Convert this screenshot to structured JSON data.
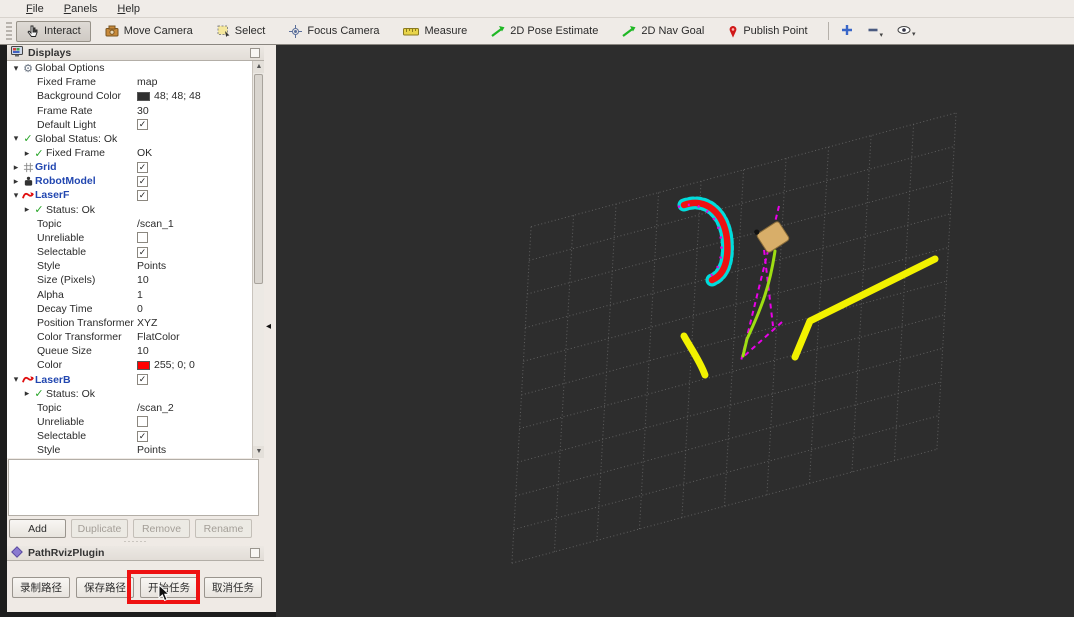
{
  "menu_bar": {
    "items": [
      {
        "label": "File"
      },
      {
        "label": "Panels"
      },
      {
        "label": "Help"
      }
    ]
  },
  "toolbar": {
    "tools": [
      {
        "label": "Interact",
        "icon": "interact-hand-icon",
        "active": true
      },
      {
        "label": "Move Camera",
        "icon": "move-camera-icon",
        "active": false
      },
      {
        "label": "Select",
        "icon": "select-box-icon",
        "active": false
      },
      {
        "label": "Focus Camera",
        "icon": "focus-camera-icon",
        "active": false
      },
      {
        "label": "Measure",
        "icon": "measure-ruler-icon",
        "active": false
      },
      {
        "label": "2D Pose Estimate",
        "icon": "pose-estimate-arrow-icon",
        "active": false
      },
      {
        "label": "2D Nav Goal",
        "icon": "nav-goal-arrow-icon",
        "active": false
      },
      {
        "label": "Publish Point",
        "icon": "publish-point-pin-icon",
        "active": false
      }
    ],
    "icon_tools": [
      {
        "name": "add-tool-plus-icon",
        "has_dropdown": false
      },
      {
        "name": "remove-tool-minus-icon",
        "has_dropdown": true
      },
      {
        "name": "tool-properties-eye-icon",
        "has_dropdown": true
      }
    ]
  },
  "displays_panel": {
    "title": "Displays",
    "tree": [
      {
        "indent": 0,
        "expander": "open",
        "icon": "gear-icon",
        "label": "Global Options",
        "style": "plain",
        "value": null
      },
      {
        "indent": 1,
        "expander": null,
        "icon": null,
        "label": "Fixed Frame",
        "style": "plain",
        "value": {
          "type": "text",
          "text": "map"
        }
      },
      {
        "indent": 1,
        "expander": null,
        "icon": null,
        "label": "Background Color",
        "style": "plain",
        "value": {
          "type": "color",
          "hex": "#303030",
          "text": "48; 48; 48"
        }
      },
      {
        "indent": 1,
        "expander": null,
        "icon": null,
        "label": "Frame Rate",
        "style": "plain",
        "value": {
          "type": "text",
          "text": "30"
        }
      },
      {
        "indent": 1,
        "expander": null,
        "icon": null,
        "label": "Default Light",
        "style": "plain",
        "value": {
          "type": "checkbox",
          "checked": true
        }
      },
      {
        "indent": 0,
        "expander": "open",
        "icon": "status-ok-icon",
        "label": "Global Status: Ok",
        "style": "plain",
        "value": null
      },
      {
        "indent": 1,
        "expander": "closed",
        "icon": "status-ok-icon",
        "label": "Fixed Frame",
        "style": "plain",
        "value": {
          "type": "text",
          "text": "OK"
        }
      },
      {
        "indent": 0,
        "expander": "closed",
        "icon": "grid-icon",
        "label": "Grid",
        "style": "blue",
        "value": {
          "type": "checkbox",
          "checked": true
        }
      },
      {
        "indent": 0,
        "expander": "closed",
        "icon": "robot-icon",
        "label": "RobotModel",
        "style": "blue",
        "value": {
          "type": "checkbox",
          "checked": true
        }
      },
      {
        "indent": 0,
        "expander": "open",
        "icon": "laser-icon",
        "label": "LaserF",
        "style": "blue",
        "value": {
          "type": "checkbox",
          "checked": true
        }
      },
      {
        "indent": 1,
        "expander": "closed",
        "icon": "status-ok-icon",
        "label": "Status: Ok",
        "style": "plain",
        "value": null
      },
      {
        "indent": 1,
        "expander": null,
        "icon": null,
        "label": "Topic",
        "style": "plain",
        "value": {
          "type": "text",
          "text": "/scan_1"
        }
      },
      {
        "indent": 1,
        "expander": null,
        "icon": null,
        "label": "Unreliable",
        "style": "plain",
        "value": {
          "type": "checkbox",
          "checked": false
        }
      },
      {
        "indent": 1,
        "expander": null,
        "icon": null,
        "label": "Selectable",
        "style": "plain",
        "value": {
          "type": "checkbox",
          "checked": true
        }
      },
      {
        "indent": 1,
        "expander": null,
        "icon": null,
        "label": "Style",
        "style": "plain",
        "value": {
          "type": "text",
          "text": "Points"
        }
      },
      {
        "indent": 1,
        "expander": null,
        "icon": null,
        "label": "Size (Pixels)",
        "style": "plain",
        "value": {
          "type": "text",
          "text": "10"
        }
      },
      {
        "indent": 1,
        "expander": null,
        "icon": null,
        "label": "Alpha",
        "style": "plain",
        "value": {
          "type": "text",
          "text": "1"
        }
      },
      {
        "indent": 1,
        "expander": null,
        "icon": null,
        "label": "Decay Time",
        "style": "plain",
        "value": {
          "type": "text",
          "text": "0"
        }
      },
      {
        "indent": 1,
        "expander": null,
        "icon": null,
        "label": "Position Transformer",
        "style": "plain",
        "value": {
          "type": "text",
          "text": "XYZ"
        }
      },
      {
        "indent": 1,
        "expander": null,
        "icon": null,
        "label": "Color Transformer",
        "style": "plain",
        "value": {
          "type": "text",
          "text": "FlatColor"
        }
      },
      {
        "indent": 1,
        "expander": null,
        "icon": null,
        "label": "Queue Size",
        "style": "plain",
        "value": {
          "type": "text",
          "text": "10"
        }
      },
      {
        "indent": 1,
        "expander": null,
        "icon": null,
        "label": "Color",
        "style": "plain",
        "value": {
          "type": "color",
          "hex": "#ff0000",
          "text": "255; 0; 0"
        }
      },
      {
        "indent": 0,
        "expander": "open",
        "icon": "laser-icon",
        "label": "LaserB",
        "style": "blue",
        "value": {
          "type": "checkbox",
          "checked": true
        }
      },
      {
        "indent": 1,
        "expander": "closed",
        "icon": "status-ok-icon",
        "label": "Status: Ok",
        "style": "plain",
        "value": null
      },
      {
        "indent": 1,
        "expander": null,
        "icon": null,
        "label": "Topic",
        "style": "plain",
        "value": {
          "type": "text",
          "text": "/scan_2"
        }
      },
      {
        "indent": 1,
        "expander": null,
        "icon": null,
        "label": "Unreliable",
        "style": "plain",
        "value": {
          "type": "checkbox",
          "checked": false
        }
      },
      {
        "indent": 1,
        "expander": null,
        "icon": null,
        "label": "Selectable",
        "style": "plain",
        "value": {
          "type": "checkbox",
          "checked": true
        }
      },
      {
        "indent": 1,
        "expander": null,
        "icon": null,
        "label": "Style",
        "style": "plain",
        "value": {
          "type": "text",
          "text": "Points"
        }
      }
    ],
    "action_buttons": [
      {
        "label": "Add",
        "enabled": true
      },
      {
        "label": "Duplicate",
        "enabled": false
      },
      {
        "label": "Remove",
        "enabled": false
      },
      {
        "label": "Rename",
        "enabled": false
      }
    ]
  },
  "path_plugin_panel": {
    "title": "PathRvizPlugin",
    "buttons": [
      {
        "label": "录制路径",
        "highlighted": false
      },
      {
        "label": "保存路径",
        "highlighted": false
      },
      {
        "label": "开始任务",
        "highlighted": true
      },
      {
        "label": "取消任务",
        "highlighted": false
      }
    ],
    "annotation_color": "#ee1111"
  },
  "viewport": {
    "background_color": "#2d2d2d",
    "grid": {
      "cells": 10,
      "color": "#606060"
    },
    "scene": {
      "laser_front": {
        "color": "#ee1111",
        "outline_color": "#00dcdc",
        "accent_color": "#e800e8"
      },
      "planned_path": {
        "color": "#e800e8",
        "style": "dashed"
      },
      "walls_laser_rear": {
        "color": "#f2f200"
      },
      "trail": {
        "color": "#9ede12"
      },
      "robot": {
        "body_color": "#d8ae69",
        "edge_color": "#8a6d3a"
      }
    }
  }
}
